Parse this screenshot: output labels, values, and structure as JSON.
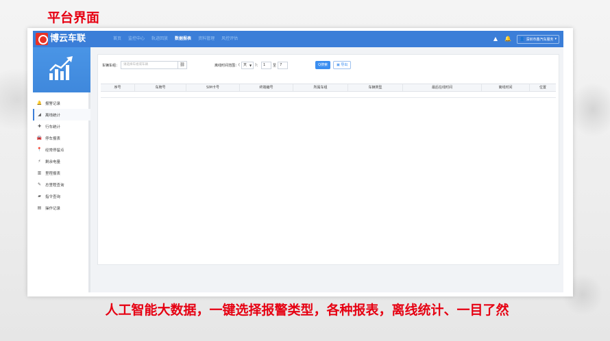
{
  "slide": {
    "title": "平台界面",
    "caption": "人工智能大数据，一键选择报警类型，各种报表，离线统计、一目了然"
  },
  "app": {
    "brand": "博云车联",
    "nav": [
      {
        "label": "首页",
        "active": false
      },
      {
        "label": "监控中心",
        "active": false
      },
      {
        "label": "轨迹回放",
        "active": false
      },
      {
        "label": "数据报表",
        "active": true
      },
      {
        "label": "资料管理",
        "active": false
      },
      {
        "label": "风控评估",
        "active": false
      }
    ],
    "user": "深圳市鑫汽车服务",
    "icons": {
      "warning": "warning-icon",
      "bell": "bell-icon",
      "user": "user-icon"
    },
    "accent_color": "#3b7ed8"
  },
  "sidebar": {
    "items": [
      {
        "label": "报警记录",
        "icon": "bell-icon",
        "glyph": "🔔",
        "active": false
      },
      {
        "label": "离线统计",
        "icon": "signal-icon",
        "glyph": "◢",
        "active": true
      },
      {
        "label": "行车统计",
        "icon": "plus-icon",
        "glyph": "✚",
        "active": false
      },
      {
        "label": "停车报表",
        "icon": "car-icon",
        "glyph": "🚘",
        "active": false
      },
      {
        "label": "经常停留点",
        "icon": "map-pin-icon",
        "glyph": "📍",
        "active": false
      },
      {
        "label": "剩余电量",
        "icon": "bolt-icon",
        "glyph": "⚡",
        "active": false
      },
      {
        "label": "里程报表",
        "icon": "bar-chart-icon",
        "glyph": "▥",
        "active": false
      },
      {
        "label": "总里程查询",
        "icon": "edit-icon",
        "glyph": "✎",
        "active": false
      },
      {
        "label": "指令查询",
        "icon": "command-icon",
        "glyph": "▰",
        "active": false
      },
      {
        "label": "操作记录",
        "icon": "file-icon",
        "glyph": "▤",
        "active": false
      }
    ]
  },
  "filter": {
    "vehicle_label": "车辆车组：",
    "vehicle_placeholder": "请选择车组或车辆",
    "offline_label": "离线时间范围：",
    "offline_unit": "天",
    "paren_open": "(",
    "paren_close": ")",
    "colon": "：",
    "min_value": "1",
    "to_label": "至",
    "max_value": "7",
    "search_label": "Q搜索",
    "export_label": "导出"
  },
  "table": {
    "columns": [
      "序号",
      "车牌号",
      "SIM卡号",
      "终端编号",
      "所属车组",
      "车辆类型",
      "最后在线时间",
      "离线时间",
      "位置"
    ]
  }
}
